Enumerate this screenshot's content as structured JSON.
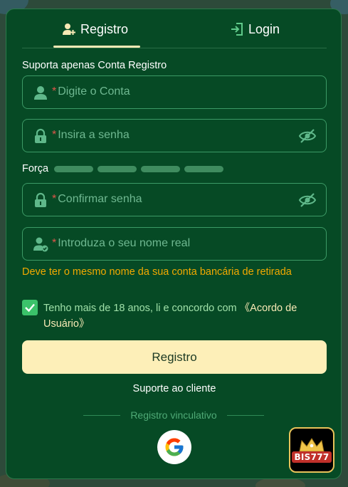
{
  "tabs": {
    "registro": "Registro",
    "login": "Login"
  },
  "caption": "Suporta apenas Conta Registro",
  "fields": {
    "conta_placeholder": "Digite o Conta",
    "senha_placeholder": "Insira a senha",
    "confirm_placeholder": "Confirmar senha",
    "nome_placeholder": "Introduza o seu nome real",
    "required_mark": "*"
  },
  "strength": {
    "label": "Força",
    "bars": 4
  },
  "warning": "Deve ter o mesmo nome da sua conta bancária de retirada",
  "agreement": {
    "checked": true,
    "text": "Tenho mais de 18 anos, li e concordo com ",
    "link": "《Acordo de Usuário》"
  },
  "buttons": {
    "registro": "Registro",
    "suporte": "Suporte ao cliente"
  },
  "divider_text": "Registro vinculativo",
  "badge_text": "BIS777",
  "colors": {
    "panel": "#064a25",
    "accent": "#fdefb8",
    "warning": "#f2a900",
    "required": "#e0554a",
    "checkbox": "#3bc26a"
  }
}
